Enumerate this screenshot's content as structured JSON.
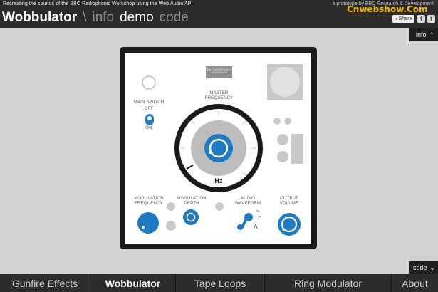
{
  "header": {
    "subtitle": "Recreating the sounds of the BBC Radiophonic Workshop using the Web Audio API",
    "credit": "a prototype by BBC Research & Development",
    "brand": "Wobbulator",
    "separator": "\\",
    "nav": [
      "info",
      "demo",
      "code"
    ],
    "active_nav": "demo",
    "share_label": "Share",
    "facebook": "f",
    "twitter": "t"
  },
  "watermark": "Cnwebshow.Com",
  "side_tabs": {
    "info": "info",
    "code": "code"
  },
  "device": {
    "plate_text": "BBC RADIOPHONIC WORKSHOP",
    "main_switch": {
      "label": "MAIN SWITCH",
      "off": "OFF",
      "on": "ON"
    },
    "master_frequency": {
      "label": "MASTER FREQUENCY",
      "unit": "Hz"
    },
    "modulation_frequency": "MODULATION FREQUENCY",
    "modulation_depth": "MODULATION DEPTH",
    "audio_waveform": "AUDIO WAVEFORM",
    "output_volume": "OUTPUT VOLUME",
    "waveform_options": [
      "~",
      "⊓",
      "⋀"
    ]
  },
  "bottom_nav": {
    "items": [
      "Gunfire Effects",
      "Wobbulator",
      "Tape Loops",
      "Ring Modulator",
      "About"
    ],
    "active": "Wobbulator"
  },
  "colors": {
    "knob_blue": "#1f7ac4",
    "bar": "#2b2b2b",
    "accent_watermark": "#f2b600"
  }
}
